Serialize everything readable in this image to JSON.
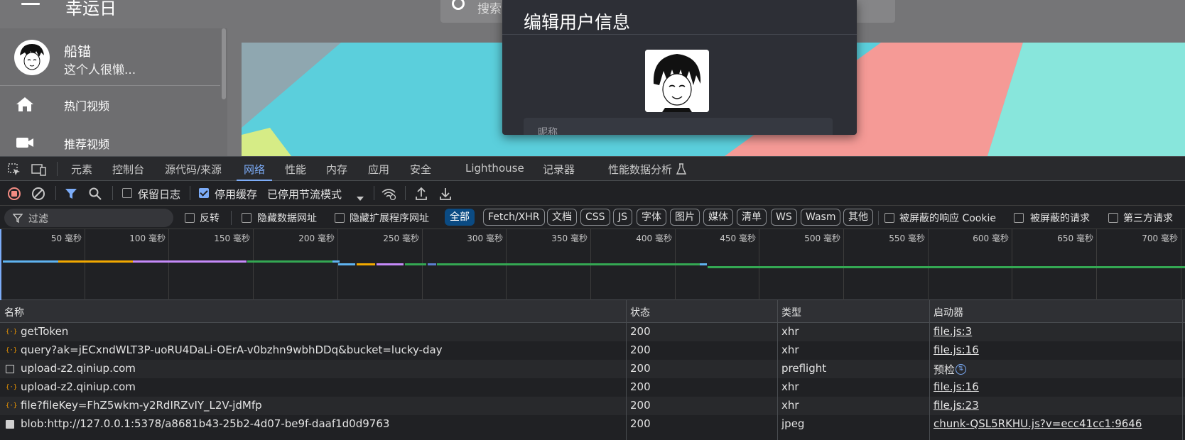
{
  "app": {
    "title": "幸运日",
    "search_placeholder": "搜索",
    "user": {
      "name": "船锚",
      "signature": "这个人很懒..."
    },
    "nav": [
      {
        "label": "热门视频",
        "icon": "home-icon"
      },
      {
        "label": "推荐视频",
        "icon": "video-camera-icon"
      }
    ]
  },
  "dialog": {
    "title": "编辑用户信息",
    "nickname_label": "昵称"
  },
  "devtools": {
    "tabs": [
      "元素",
      "控制台",
      "源代码/来源",
      "网络",
      "性能",
      "内存",
      "应用",
      "安全",
      "Lighthouse",
      "记录器",
      "性能数据分析"
    ],
    "active_tab": "网络",
    "toolbar": {
      "preserve_log": "保留日志",
      "disable_cache": "停用缓存",
      "throttle": "已停用节流模式"
    },
    "filter": {
      "placeholder": "过滤",
      "invert": "反转",
      "hide_data_urls": "隐藏数据网址",
      "hide_ext_urls": "隐藏扩展程序网址",
      "types": [
        "全部",
        "Fetch/XHR",
        "文档",
        "CSS",
        "JS",
        "字体",
        "图片",
        "媒体",
        "清单",
        "WS",
        "Wasm",
        "其他"
      ],
      "blocked_cookies": "被屏蔽的响应 Cookie",
      "blocked_requests": "被屏蔽的请求",
      "third_party": "第三方请求"
    },
    "timeline_ticks": [
      "50 毫秒",
      "100 毫秒",
      "150 毫秒",
      "200 毫秒",
      "250 毫秒",
      "300 毫秒",
      "350 毫秒",
      "400 毫秒",
      "450 毫秒",
      "500 毫秒",
      "550 毫秒",
      "600 毫秒",
      "650 毫秒",
      "700 毫秒"
    ],
    "columns": {
      "name": "名称",
      "status": "状态",
      "type": "类型",
      "initiator": "启动器"
    },
    "requests": [
      {
        "name": "getToken",
        "status": "200",
        "type": "xhr",
        "initiator": "file.js:3",
        "icon": "xhr-icon"
      },
      {
        "name": "query?ak=jECxndWLT3P-uoRU4DaLi-OErA-v0bzhn9wbhDDq&bucket=lucky-day",
        "status": "200",
        "type": "xhr",
        "initiator": "file.js:16",
        "icon": "xhr-icon"
      },
      {
        "name": "upload-z2.qiniup.com",
        "status": "200",
        "type": "preflight",
        "initiator": "预检",
        "icon": "preflight-icon"
      },
      {
        "name": "upload-z2.qiniup.com",
        "status": "200",
        "type": "xhr",
        "initiator": "file.js:16",
        "icon": "xhr-icon"
      },
      {
        "name": "file?fileKey=FhZ5wkm-y2RdIRZvIY_L2V-jdMfp",
        "status": "200",
        "type": "xhr",
        "initiator": "file.js:23",
        "icon": "xhr-icon"
      },
      {
        "name": "blob:http://127.0.0.1:5378/a8681b43-25b2-4d07-be9f-daaf1d0d9763",
        "status": "200",
        "type": "jpeg",
        "initiator": "chunk-QSL5RKHU.js?v=ecc41cc1:9646",
        "icon": "image-icon"
      }
    ]
  }
}
